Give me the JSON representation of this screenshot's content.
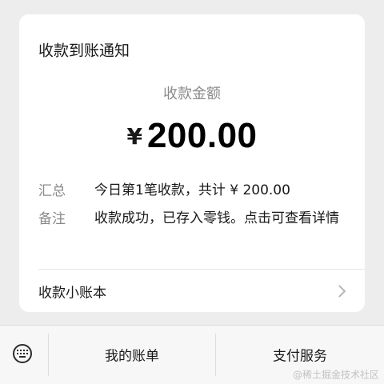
{
  "card": {
    "title": "收款到账通知",
    "amount_label": "收款金额",
    "currency_symbol": "¥",
    "amount": "200.00",
    "rows": [
      {
        "label": "汇总",
        "value": "今日第1笔收款，共计 ¥ 200.00"
      },
      {
        "label": "备注",
        "value": "收款成功，已存入零钱。点击可查看详情"
      }
    ],
    "ledger_label": "收款小账本"
  },
  "bottom_bar": {
    "keyboard_icon": "keyboard-icon",
    "menu_1": "我的账单",
    "menu_2": "支付服务"
  },
  "watermark": "@稀土掘金技术社区"
}
